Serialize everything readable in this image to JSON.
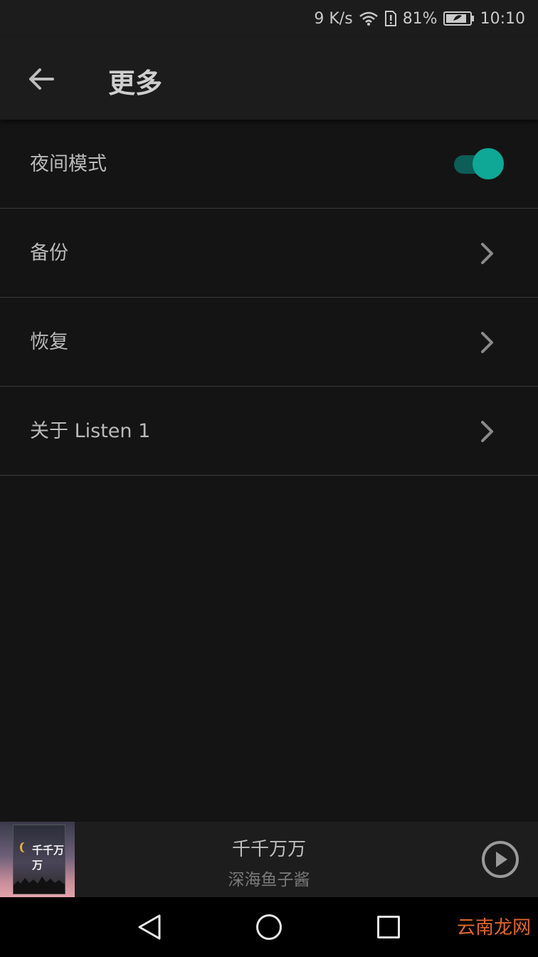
{
  "status_bar": {
    "net_speed": "9 K/s",
    "battery": "81%",
    "time": "10:10"
  },
  "header": {
    "title": "更多"
  },
  "settings": [
    {
      "label": "夜间模式",
      "control": "toggle",
      "on": true
    },
    {
      "label": "备份",
      "control": "chevron"
    },
    {
      "label": "恢复",
      "control": "chevron"
    },
    {
      "label": "关于 Listen 1",
      "control": "chevron"
    }
  ],
  "player": {
    "cover_text": "千千万万",
    "title": "千千万万",
    "artist": "深海鱼子酱"
  },
  "watermark": "云南龙网",
  "colors": {
    "accent": "#0fa896",
    "background": "#141414"
  }
}
